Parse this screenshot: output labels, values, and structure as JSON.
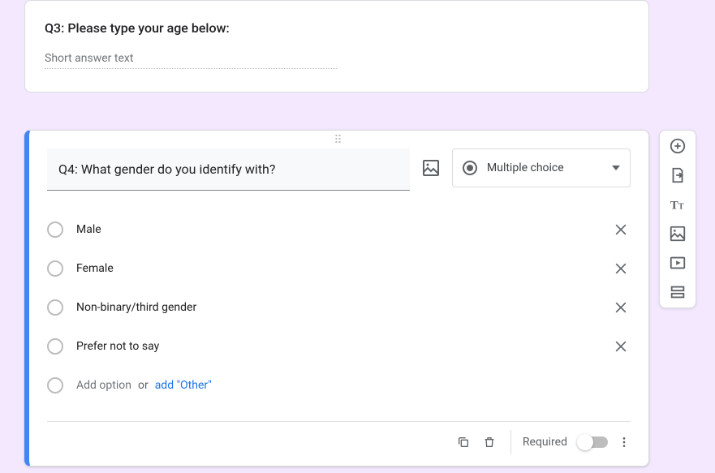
{
  "q3": {
    "title": "Q3: Please type your age below:",
    "placeholder": "Short answer text"
  },
  "q4": {
    "title": "Q4: What gender do you identify with?",
    "question_type_label": "Multiple choice",
    "options": [
      {
        "label": "Male"
      },
      {
        "label": "Female"
      },
      {
        "label": "Non-binary/third gender"
      },
      {
        "label": "Prefer not to say"
      }
    ],
    "add_option_text": "Add option",
    "or_text": "or",
    "add_other_text": "add \"Other\"",
    "required_label": "Required"
  }
}
